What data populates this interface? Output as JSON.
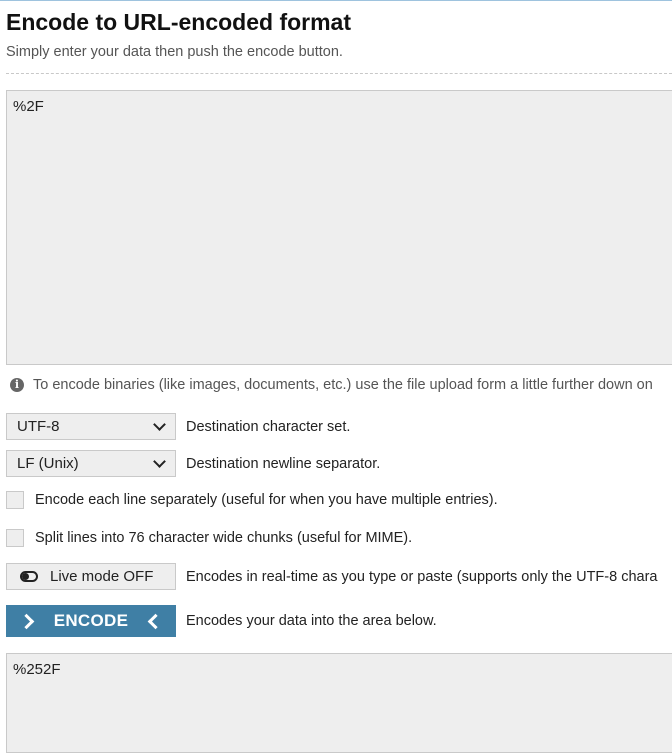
{
  "header": {
    "title": "Encode to URL-encoded format",
    "subtitle": "Simply enter your data then push the encode button."
  },
  "input": {
    "value": "%2F"
  },
  "info": {
    "icon": "info-icon",
    "text": "To encode binaries (like images, documents, etc.) use the file upload form a little further down on"
  },
  "charset": {
    "selected": "UTF-8",
    "label": "Destination character set."
  },
  "newline": {
    "selected": "LF (Unix)",
    "label": "Destination newline separator."
  },
  "options": {
    "each_line": {
      "label": "Encode each line separately (useful for when you have multiple entries).",
      "checked": false
    },
    "split_lines": {
      "label": "Split lines into 76 character wide chunks (useful for MIME).",
      "checked": false
    }
  },
  "live_mode": {
    "label": "Live mode OFF",
    "description": "Encodes in real-time as you type or paste (supports only the UTF-8 chara"
  },
  "encode": {
    "label": "ENCODE",
    "description": "Encodes your data into the area below.",
    "color": "#3f7fa5"
  },
  "output": {
    "value": "%252F"
  }
}
